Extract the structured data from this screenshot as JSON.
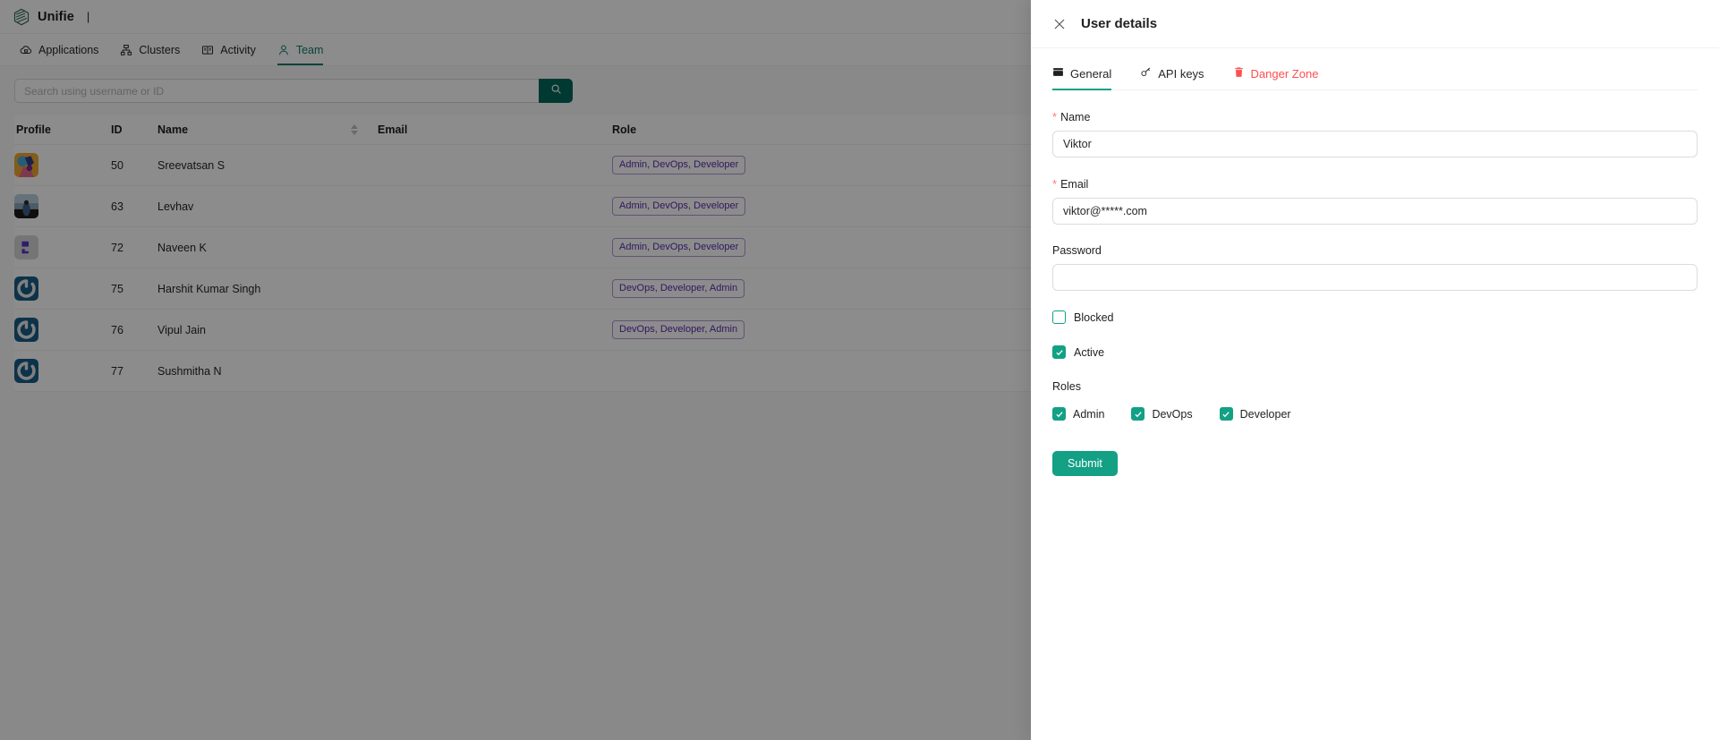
{
  "app": {
    "brand": "Unifie",
    "brand_separator": "|",
    "accent": "#0f7b6c",
    "teal": "#13a085",
    "search_button_color": "#00695c",
    "danger_color": "#ff4d4f",
    "role_badge_color": "#5b2bb0"
  },
  "nav": {
    "items": [
      {
        "label": "Applications",
        "icon": "cloud-apps-icon",
        "active": false
      },
      {
        "label": "Clusters",
        "icon": "cluster-icon",
        "active": false
      },
      {
        "label": "Activity",
        "icon": "book-icon",
        "active": false
      },
      {
        "label": "Team",
        "icon": "user-icon",
        "active": true
      }
    ]
  },
  "search": {
    "value": "",
    "placeholder": "Search using username or ID",
    "icon": "search-icon"
  },
  "table": {
    "columns": [
      "Profile",
      "ID",
      "Name",
      "Email",
      "Role"
    ],
    "sortable_column": "Name",
    "rows": [
      {
        "id": "50",
        "name": "Sreevatsan S",
        "email": "",
        "role": "Admin, DevOps, Developer",
        "avatar": "photo-orange"
      },
      {
        "id": "63",
        "name": "Levhav",
        "email": "",
        "role": "Admin, DevOps, Developer",
        "avatar": "photo-beach"
      },
      {
        "id": "72",
        "name": "Naveen K",
        "email": "",
        "role": "Admin, DevOps, Developer",
        "avatar": "glyph-purple"
      },
      {
        "id": "75",
        "name": "Harshit Kumar Singh",
        "email": "",
        "role": "DevOps, Developer, Admin",
        "avatar": "gravatar-blue"
      },
      {
        "id": "76",
        "name": "Vipul Jain",
        "email": "",
        "role": "DevOps, Developer, Admin",
        "avatar": "gravatar-blue"
      },
      {
        "id": "77",
        "name": "Sushmitha N",
        "email": "",
        "role": "",
        "avatar": "gravatar-blue"
      }
    ]
  },
  "drawer": {
    "title": "User details",
    "close_icon": "close-icon",
    "tabs": [
      {
        "label": "General",
        "icon": "card-icon",
        "active": true,
        "danger": false
      },
      {
        "label": "API keys",
        "icon": "key-icon",
        "active": false,
        "danger": false
      },
      {
        "label": "Danger Zone",
        "icon": "trash-icon",
        "active": false,
        "danger": true
      }
    ],
    "form": {
      "name": {
        "label": "Name",
        "value": "Viktor",
        "placeholder": "",
        "required": true
      },
      "email": {
        "label": "Email",
        "value": "viktor@*****.com",
        "placeholder": "",
        "required": true
      },
      "password": {
        "label": "Password",
        "value": "",
        "placeholder": "",
        "required": false
      },
      "blocked": {
        "label": "Blocked",
        "checked": false
      },
      "active": {
        "label": "Active",
        "checked": true
      },
      "roles_title": "Roles",
      "roles": [
        {
          "label": "Admin",
          "checked": true
        },
        {
          "label": "DevOps",
          "checked": true
        },
        {
          "label": "Developer",
          "checked": true
        }
      ],
      "submit_label": "Submit"
    }
  }
}
